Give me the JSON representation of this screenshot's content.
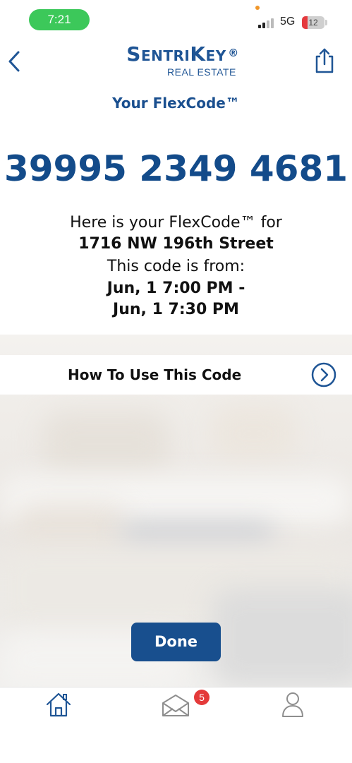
{
  "status_bar": {
    "time": "7:21",
    "network": "5G",
    "battery": "12",
    "colors": {
      "time_pill": "#3cc85a",
      "battery_low": "#e5393d"
    }
  },
  "header": {
    "brand_name": "SentriKey",
    "brand_reg": "®",
    "brand_sub": "REAL ESTATE",
    "back_icon": "chevron-left-icon",
    "share_icon": "share-icon"
  },
  "flexcode": {
    "title": "Your FlexCode™",
    "code": "39995 2349 4681",
    "intro": "Here is your FlexCode™ for",
    "address": "1716 NW 196th Street",
    "range_label": "This code is from:",
    "start": "Jun, 1 7:00 PM -",
    "end": "Jun, 1 7:30 PM"
  },
  "howto": {
    "label": "How To Use This Code",
    "icon": "chevron-right-circle-icon"
  },
  "done_label": "Done",
  "tabbar": {
    "items": [
      {
        "icon": "home-icon"
      },
      {
        "icon": "mail-icon",
        "badge": "5"
      },
      {
        "icon": "profile-icon"
      }
    ]
  },
  "colors": {
    "brand_blue": "#1f5595",
    "code_blue": "#134b8a",
    "button_blue": "#184f8e",
    "badge_red": "#e43a3a"
  }
}
